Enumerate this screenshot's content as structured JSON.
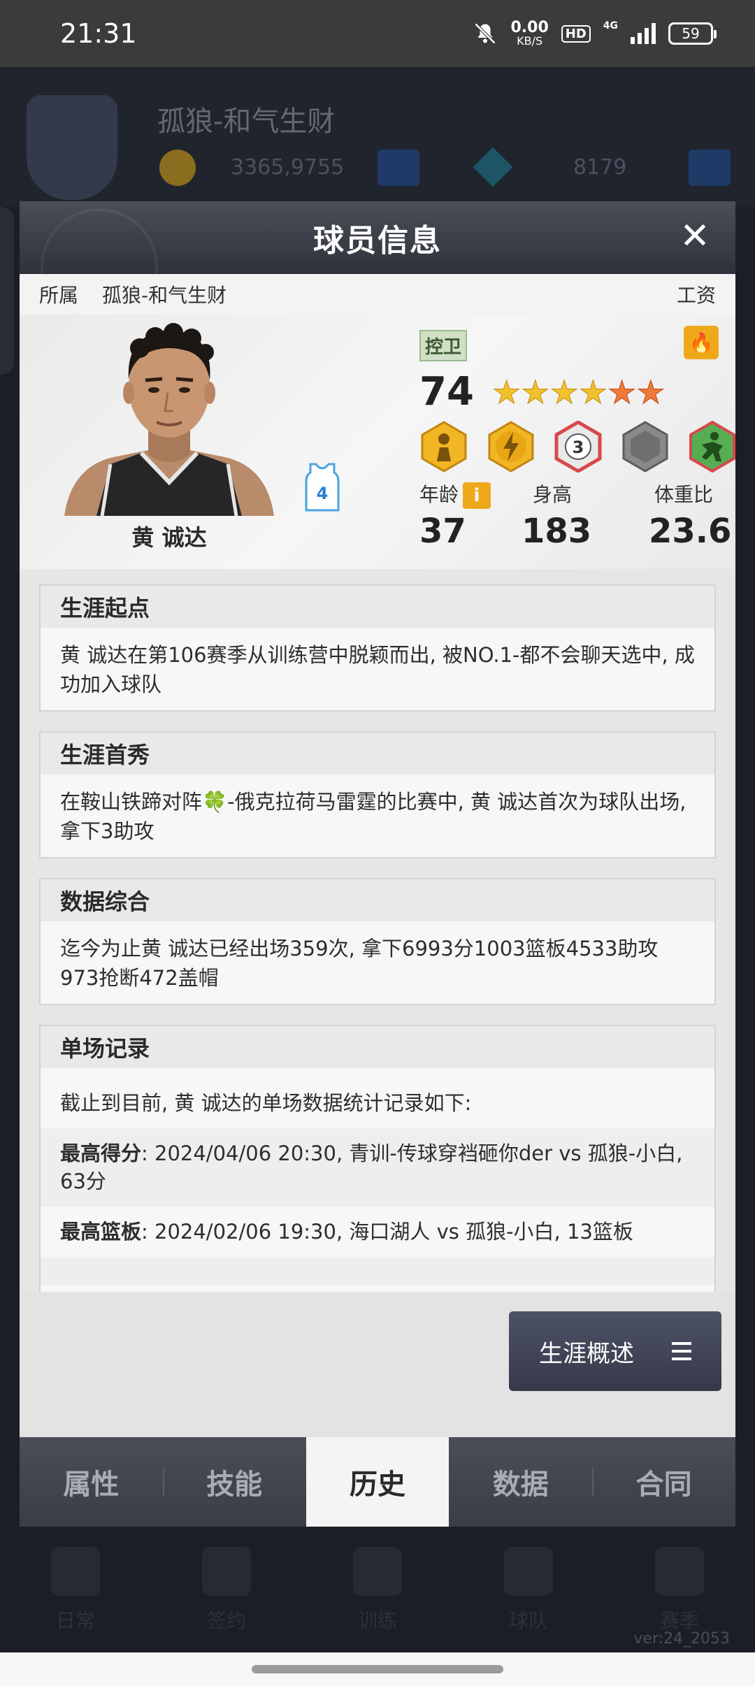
{
  "status_bar": {
    "time": "21:31",
    "net_speed": "0.00",
    "net_unit": "KB/S",
    "hd": "HD",
    "network": "4G",
    "battery": "59"
  },
  "modal": {
    "title": "球员信息",
    "team_label": "所属",
    "team_name": "孤狼-和气生财",
    "salary_label": "工资",
    "player": {
      "name": "黄 诚达",
      "jersey_number": "4",
      "position": "控卫",
      "overall": "74",
      "stars": {
        "filled_gold": 4,
        "filled_orange": 2,
        "total": 6
      },
      "stats": {
        "age_label": "年龄",
        "age": "37",
        "height_label": "身高",
        "height": "183",
        "bmi_label": "体重比",
        "bmi": "23.6"
      },
      "skills": [
        {
          "icon": "player-gold-badge-icon",
          "color": "#f0b21e"
        },
        {
          "icon": "lightning-gold-badge-icon",
          "color": "#f0b21e"
        },
        {
          "icon": "three-point-red-badge-icon",
          "color": "#d8484c",
          "text": "3"
        },
        {
          "icon": "hexagon-gray-badge-icon",
          "color": "#7a7a7a"
        },
        {
          "icon": "defender-green-badge-icon",
          "color": "#4ea44a"
        }
      ]
    },
    "history": {
      "career_start": {
        "title": "生涯起点",
        "text": "黄 诚达在第106赛季从训练营中脱颖而出, 被NO.1-都不会聊天选中, 成功加入球队"
      },
      "debut": {
        "title": "生涯首秀",
        "text": "在鞍山铁蹄对阵🍀-俄克拉荷马雷霆的比赛中, 黄 诚达首次为球队出场, 拿下3助攻"
      },
      "summary": {
        "title": "数据综合",
        "text": "迄今为止黄 诚达已经出场359次, 拿下6993分1003篮板4533助攻973抢断472盖帽"
      },
      "records": {
        "title": "单场记录",
        "intro": "截止到目前, 黄 诚达的单场数据统计记录如下:",
        "items": [
          {
            "label": "最高得分",
            "text": ": 2024/04/06 20:30, 青训-传球穿裆砸你der vs 孤狼-小白, 63分"
          },
          {
            "label": "最高篮板",
            "text": ": 2024/02/06 19:30, 海口湖人 vs 孤狼-小白, 13篮板"
          }
        ]
      }
    },
    "career_button": "生涯概述",
    "tabs": [
      {
        "label": "属性",
        "active": false
      },
      {
        "label": "技能",
        "active": false
      },
      {
        "label": "历史",
        "active": true
      },
      {
        "label": "数据",
        "active": false
      },
      {
        "label": "合同",
        "active": false
      }
    ]
  },
  "background": {
    "team_title": "孤狼-和气生财",
    "coins": "3365,9755",
    "gems": "8179",
    "nav": [
      "日常",
      "签约",
      "训练",
      "球队",
      "赛季"
    ],
    "version": "ver:24_2053"
  },
  "colors": {
    "modal_header": "#3a3d46",
    "accent_orange": "#f0a81b",
    "tab_active_bg": "#f4f4f4"
  }
}
